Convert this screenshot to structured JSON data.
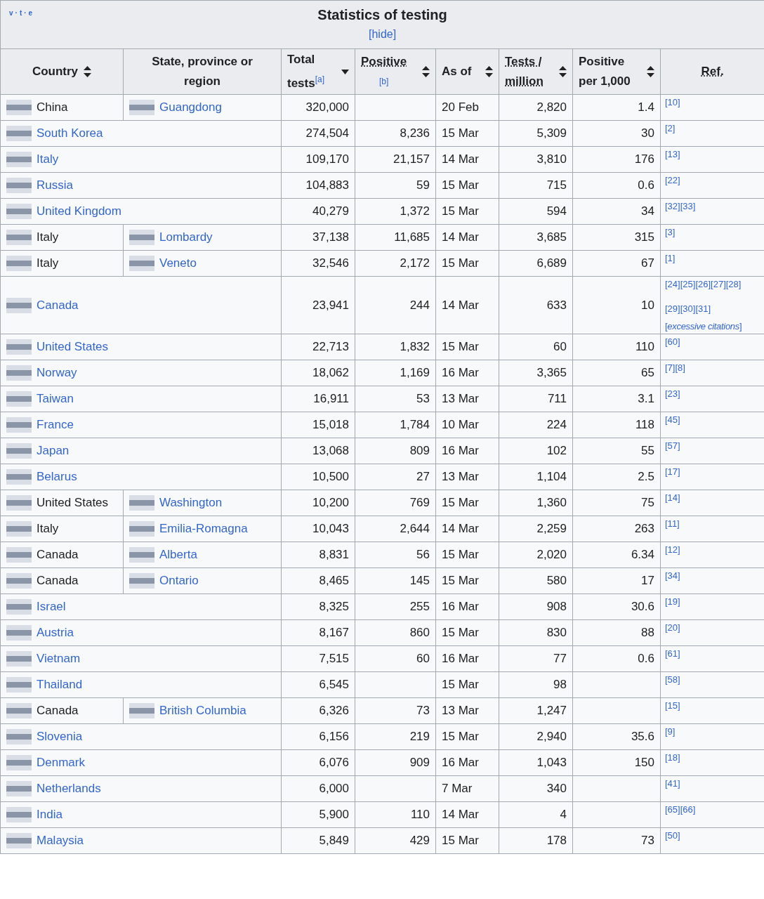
{
  "title": "Statistics of testing",
  "toggle": "[hide]",
  "vte": {
    "links": [
      "v",
      "t",
      "e"
    ],
    "separator": "·"
  },
  "columns": [
    {
      "label": "Country",
      "sortable": true,
      "sorted": false,
      "abbr": false
    },
    {
      "label": "State, province or region",
      "sortable": false,
      "sorted": false,
      "abbr": false
    },
    {
      "label": "Total tests$^{[a]}$",
      "sortable": true,
      "sorted": true,
      "abbr": false
    },
    {
      "label": "Positive",
      "note": "[b]",
      "sortable": true,
      "sorted": false,
      "abbr": true
    },
    {
      "label": "As of",
      "sortable": true,
      "sorted": false,
      "abbr": false
    },
    {
      "label": "Tests / million",
      "sortable": true,
      "sorted": false,
      "abbr": true
    },
    {
      "label": "Positive per 1,000",
      "sortable": true,
      "sorted": false,
      "abbr": false
    },
    {
      "label": "Ref.",
      "sortable": false,
      "sorted": false,
      "abbr": true
    }
  ],
  "rows": [
    {
      "country": "China",
      "country_link": false,
      "region": "Guangdong",
      "total": "320,000",
      "as_of": "20 Feb",
      "tests_per_million": "2,820",
      "positive_per_1000": "1.4",
      "refs": [
        "[10]"
      ]
    },
    {
      "country": "South Korea",
      "country_link": true,
      "total": "274,504",
      "positive": "8,236",
      "as_of": "15 Mar",
      "tests_per_million": "5,309",
      "positive_per_1000": "30",
      "refs": [
        "[2]"
      ]
    },
    {
      "country": "Italy",
      "country_link": true,
      "total": "109,170",
      "positive": "21,157",
      "as_of": "14 Mar",
      "tests_per_million": "3,810",
      "positive_per_1000": "176",
      "refs": [
        "[13]"
      ]
    },
    {
      "country": "Russia",
      "country_link": true,
      "total": "104,883",
      "positive": "59",
      "as_of": "15 Mar",
      "tests_per_million": "715",
      "positive_per_1000": "0.6",
      "refs": [
        "[22]"
      ]
    },
    {
      "country": "United Kingdom",
      "country_link": true,
      "total": "40,279",
      "positive": "1,372",
      "as_of": "15 Mar",
      "tests_per_million": "594",
      "positive_per_1000": "34",
      "refs": [
        "[32]",
        "[33]"
      ]
    },
    {
      "country": "Italy",
      "country_link": false,
      "region": "Lombardy",
      "total": "37,138",
      "positive": "11,685",
      "as_of": "14 Mar",
      "tests_per_million": "3,685",
      "positive_per_1000": "315",
      "refs": [
        "[3]"
      ]
    },
    {
      "country": "Italy",
      "country_link": false,
      "region": "Veneto",
      "total": "32,546",
      "positive": "2,172",
      "as_of": "15 Mar",
      "tests_per_million": "6,689",
      "positive_per_1000": "67",
      "refs": [
        "[1]"
      ]
    },
    {
      "country": "Canada",
      "country_link": true,
      "total": "23,941",
      "positive": "244",
      "as_of": "14 Mar",
      "tests_per_million": "633",
      "positive_per_1000": "10",
      "refs": [
        "[24]",
        "[25]",
        "[26]",
        "[27]",
        "[28]",
        "[29]",
        "[30]",
        "[31]"
      ],
      "ref_note": "[*excessive citations*]"
    },
    {
      "country": "United States",
      "country_link": true,
      "total": "22,713",
      "positive": "1,832",
      "as_of": "15 Mar",
      "tests_per_million": "60",
      "positive_per_1000": "110",
      "refs": [
        "[60]"
      ]
    },
    {
      "country": "Norway",
      "country_link": true,
      "total": "18,062",
      "positive": "1,169",
      "as_of": "16 Mar",
      "tests_per_million": "3,365",
      "positive_per_1000": "65",
      "refs": [
        "[7]",
        "[8]"
      ]
    },
    {
      "country": "Taiwan",
      "country_link": true,
      "total": "16,911",
      "positive": "53",
      "as_of": "13 Mar",
      "tests_per_million": "711",
      "positive_per_1000": "3.1",
      "refs": [
        "[23]"
      ]
    },
    {
      "country": "France",
      "country_link": true,
      "total": "15,018",
      "positive": "1,784",
      "as_of": "10 Mar",
      "tests_per_million": "224",
      "positive_per_1000": "118",
      "refs": [
        "[45]"
      ]
    },
    {
      "country": "Japan",
      "country_link": true,
      "total": "13,068",
      "positive": "809",
      "as_of": "16 Mar",
      "tests_per_million": "102",
      "positive_per_1000": "55",
      "refs": [
        "[57]"
      ]
    },
    {
      "country": "Belarus",
      "country_link": true,
      "total": "10,500",
      "positive": "27",
      "as_of": "13 Mar",
      "tests_per_million": "1,104",
      "positive_per_1000": "2.5",
      "refs": [
        "[17]"
      ]
    },
    {
      "country": "United States",
      "country_link": false,
      "region": "Washington",
      "total": "10,200",
      "positive": "769",
      "as_of": "15 Mar",
      "tests_per_million": "1,360",
      "positive_per_1000": "75",
      "refs": [
        "[14]"
      ]
    },
    {
      "country": "Italy",
      "country_link": false,
      "region": "Emilia-Romagna",
      "total": "10,043",
      "positive": "2,644",
      "as_of": "14 Mar",
      "tests_per_million": "2,259",
      "positive_per_1000": "263",
      "refs": [
        "[11]"
      ]
    },
    {
      "country": "Canada",
      "country_link": false,
      "region": "Alberta",
      "total": "8,831",
      "positive": "56",
      "as_of": "15 Mar",
      "tests_per_million": "2,020",
      "positive_per_1000": "6.34",
      "refs": [
        "[12]"
      ]
    },
    {
      "country": "Canada",
      "country_link": false,
      "region": "Ontario",
      "total": "8,465",
      "positive": "145",
      "as_of": "15 Mar",
      "tests_per_million": "580",
      "positive_per_1000": "17",
      "refs": [
        "[34]"
      ]
    },
    {
      "country": "Israel",
      "country_link": true,
      "total": "8,325",
      "positive": "255",
      "as_of": "16 Mar",
      "tests_per_million": "908",
      "positive_per_1000": "30.6",
      "refs": [
        "[19]"
      ]
    },
    {
      "country": "Austria",
      "country_link": true,
      "total": "8,167",
      "positive": "860",
      "as_of": "15 Mar",
      "tests_per_million": "830",
      "positive_per_1000": "88",
      "refs": [
        "[20]"
      ]
    },
    {
      "country": "Vietnam",
      "country_link": true,
      "total": "7,515",
      "positive": "60",
      "as_of": "16 Mar",
      "tests_per_million": "77",
      "positive_per_1000": "0.6",
      "refs": [
        "[61]"
      ]
    },
    {
      "country": "Thailand",
      "country_link": true,
      "total": "6,545",
      "as_of": "15 Mar",
      "tests_per_million": "98",
      "refs": [
        "[58]"
      ]
    },
    {
      "country": "Canada",
      "country_link": false,
      "region": "British Columbia",
      "total": "6,326",
      "positive": "73",
      "as_of": "13 Mar",
      "tests_per_million": "1,247",
      "refs": [
        "[15]"
      ]
    },
    {
      "country": "Slovenia",
      "country_link": true,
      "total": "6,156",
      "positive": "219",
      "as_of": "15 Mar",
      "tests_per_million": "2,940",
      "positive_per_1000": "35.6",
      "refs": [
        "[9]"
      ]
    },
    {
      "country": "Denmark",
      "country_link": true,
      "total": "6,076",
      "positive": "909",
      "as_of": "16 Mar",
      "tests_per_million": "1,043",
      "positive_per_1000": "150",
      "refs": [
        "[18]"
      ]
    },
    {
      "country": "Netherlands",
      "country_link": true,
      "total": "6,000",
      "as_of": "7 Mar",
      "tests_per_million": "340",
      "refs": [
        "[41]"
      ]
    },
    {
      "country": "India",
      "country_link": true,
      "total": "5,900",
      "positive": "110",
      "as_of": "14 Mar",
      "tests_per_million": "4",
      "refs": [
        "[65]",
        "[66]"
      ]
    },
    {
      "country": "Malaysia",
      "country_link": true,
      "total": "5,849",
      "positive": "429",
      "as_of": "15 Mar",
      "tests_per_million": "178",
      "positive_per_1000": "73",
      "refs": [
        "[50]"
      ]
    }
  ]
}
